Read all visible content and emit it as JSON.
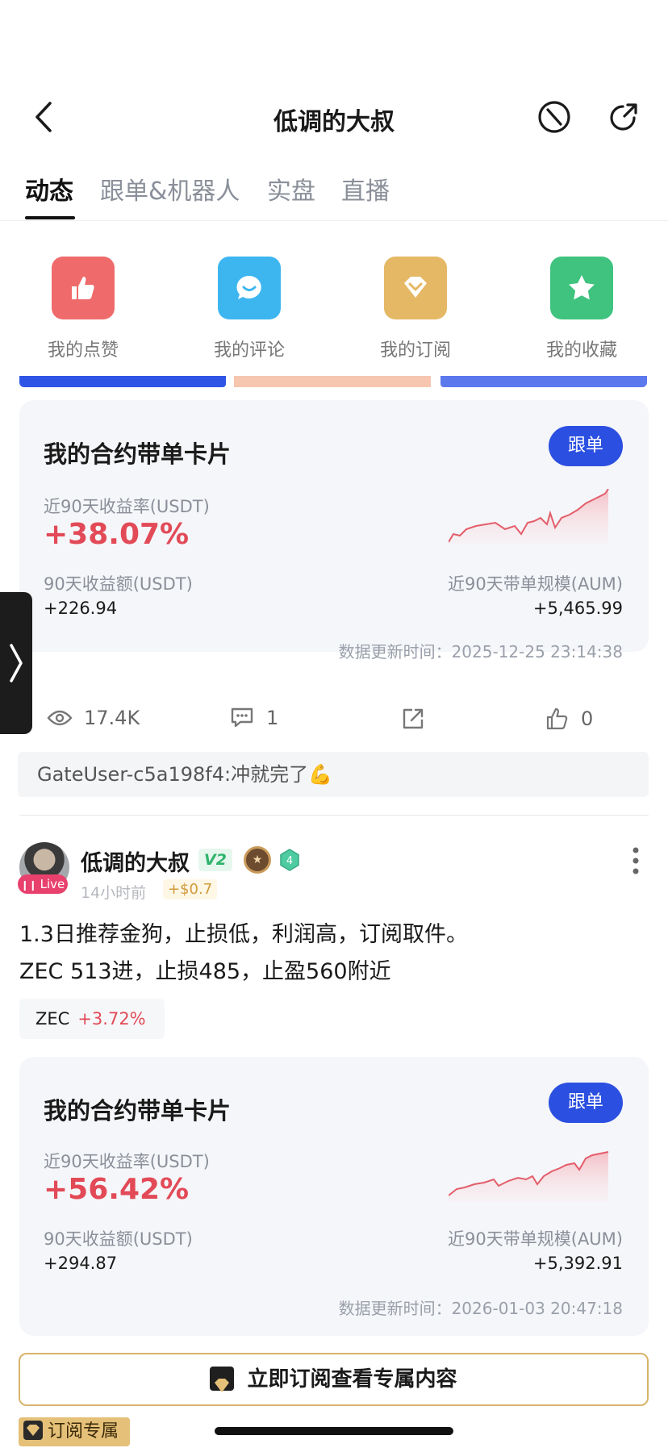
{
  "header": {
    "title": "低调的大叔"
  },
  "tabs": [
    {
      "label": "动态",
      "active": true
    },
    {
      "label": "跟单&机器人",
      "active": false
    },
    {
      "label": "实盘",
      "active": false
    },
    {
      "label": "直播",
      "active": false
    }
  ],
  "quick_actions": [
    {
      "label": "我的点赞",
      "icon": "thumbs-up-icon",
      "color": "#ef6b6b"
    },
    {
      "label": "我的评论",
      "icon": "comment-icon",
      "color": "#3db6ef"
    },
    {
      "label": "我的订阅",
      "icon": "diamond-icon",
      "color": "#e4b865"
    },
    {
      "label": "我的收藏",
      "icon": "star-icon",
      "color": "#3fc37f"
    }
  ],
  "card1": {
    "title": "我的合约带单卡片",
    "follow_label": "跟单",
    "return_label": "近90天收益率(USDT)",
    "return_value": "+38.07%",
    "profit_label": "90天收益额(USDT)",
    "profit_value": "+226.94",
    "aum_label": "近90天带单规模(AUM)",
    "aum_value": "+5,465.99",
    "update_label": "数据更新时间：",
    "update_time": "2025-12-25 23:14:38"
  },
  "stats": {
    "views": "17.4K",
    "comments": "1",
    "likes": "0"
  },
  "comment": {
    "text": "GateUser-c5a198f4:冲就完了💪"
  },
  "post": {
    "username": "低调的大叔",
    "v_badge": "V2",
    "level_badge": "4",
    "live_label": "Live",
    "time": "14小时前",
    "earn": "+$0.7",
    "line1": "1.3日推荐金狗，止损低，利润高，订阅取件。",
    "line2": "ZEC 513进，止损485，止盈560附近",
    "tag_symbol": "ZEC",
    "tag_change": "+3.72%"
  },
  "card2": {
    "title": "我的合约带单卡片",
    "follow_label": "跟单",
    "return_label": "近90天收益率(USDT)",
    "return_value": "+56.42%",
    "profit_label": "90天收益额(USDT)",
    "profit_value": "+294.87",
    "aum_label": "近90天带单规模(AUM)",
    "aum_value": "+5,392.91",
    "update_label": "数据更新时间：",
    "update_time": "2026-01-03 20:47:18"
  },
  "subscribe": {
    "button_label": "立即订阅查看专属内容",
    "exclusive_label": "订阅专属"
  },
  "colors": {
    "accent_blue": "#2b4fe0",
    "profit_red": "#e24a57",
    "gold": "#d8b46a"
  }
}
